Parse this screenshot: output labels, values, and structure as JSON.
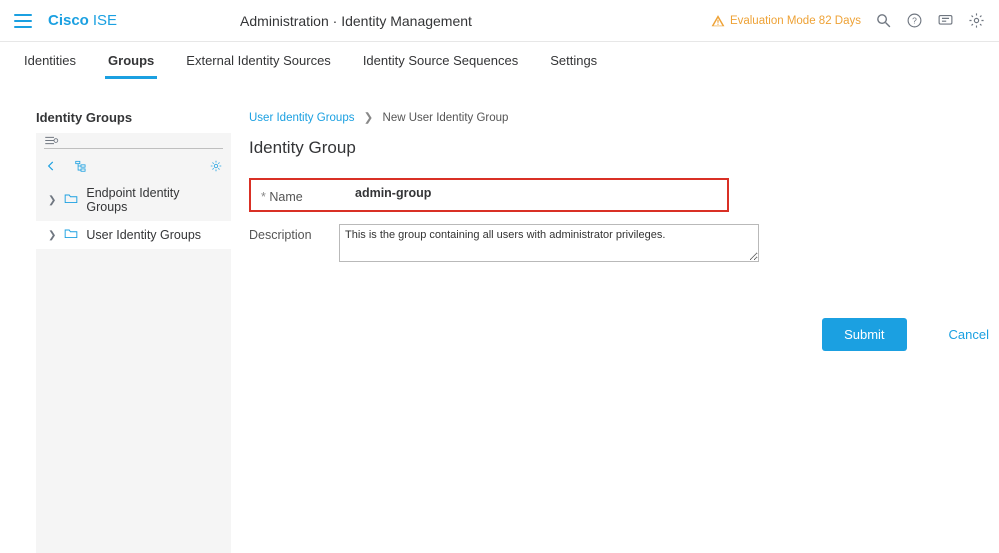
{
  "brand": {
    "main": "Cisco",
    "sub": "ISE"
  },
  "page_header": "Administration · Identity Management",
  "eval_notice": "Evaluation Mode 82 Days",
  "tabs": [
    "Identities",
    "Groups",
    "External Identity Sources",
    "Identity Source Sequences",
    "Settings"
  ],
  "active_tab": "Groups",
  "sidebar": {
    "title": "Identity Groups",
    "items": [
      "Endpoint Identity Groups",
      "User Identity Groups"
    ],
    "selected": "User Identity Groups"
  },
  "breadcrumb": {
    "link": "User Identity Groups",
    "current": "New User Identity Group"
  },
  "form": {
    "title": "Identity Group",
    "name_label": "Name",
    "name_value": "admin-group",
    "desc_label": "Description",
    "desc_value": "This is the group containing all users with administrator privileges."
  },
  "buttons": {
    "submit": "Submit",
    "cancel": "Cancel"
  }
}
